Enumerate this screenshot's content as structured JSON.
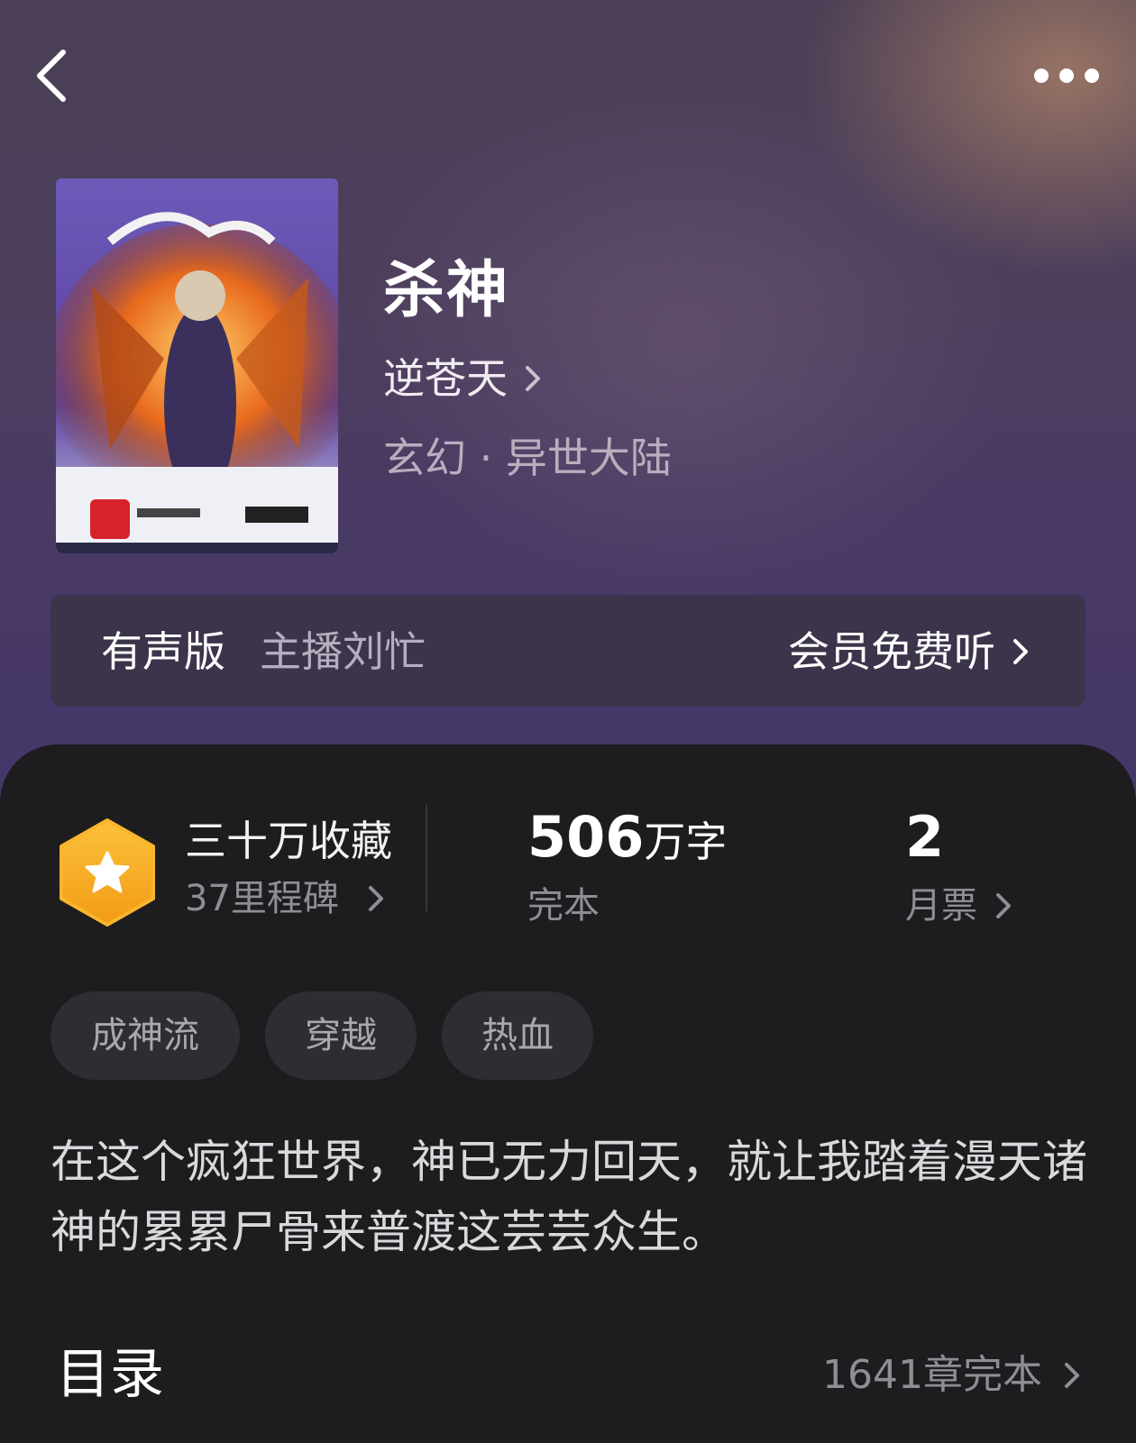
{
  "header": {
    "back_icon": "back-icon",
    "more_icon": "more-icon"
  },
  "book": {
    "cover_icon": "book-cover",
    "title": "杀神",
    "author": "逆苍天",
    "genre": "玄幻 · 异世大陆"
  },
  "audio": {
    "label": "有声版",
    "host": "主播刘忙",
    "cta": "会员免费听"
  },
  "stats": {
    "favorites": "三十万收藏",
    "milestone": "37里程碑",
    "words_number": "506",
    "words_unit": "万字",
    "status": "完本",
    "votes_number": "2",
    "votes_label": "月票"
  },
  "tags": [
    "成神流",
    "穿越",
    "热血"
  ],
  "description": "在这个疯狂世界，神已无力回天，就让我踏着漫天诸神的累累尸骨来普渡这芸芸众生。",
  "toc": {
    "title": "目录",
    "info": "1641章完本"
  },
  "colors": {
    "badge_gold": "#f5a623",
    "sheet_bg": "#1d1c1f"
  }
}
